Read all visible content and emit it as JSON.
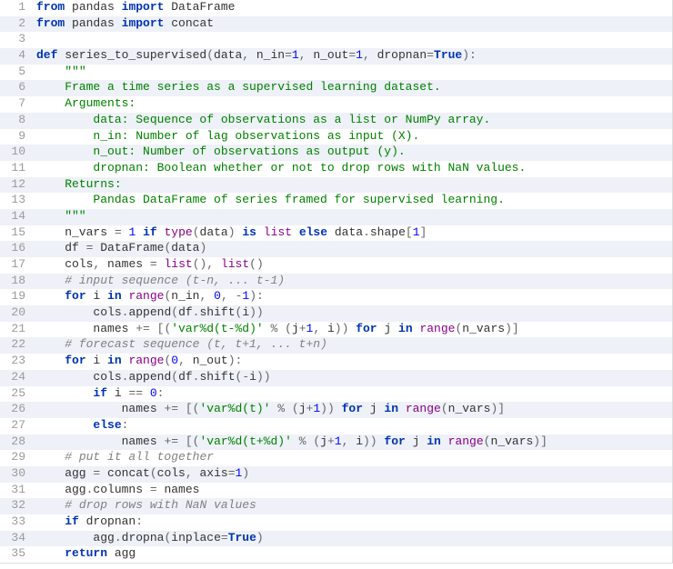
{
  "lines": [
    {
      "n": 1,
      "tokens": [
        [
          "kw",
          "from"
        ],
        [
          "name",
          " pandas "
        ],
        [
          "kw",
          "import"
        ],
        [
          "name",
          " DataFrame"
        ]
      ]
    },
    {
      "n": 2,
      "tokens": [
        [
          "kw",
          "from"
        ],
        [
          "name",
          " pandas "
        ],
        [
          "kw",
          "import"
        ],
        [
          "name",
          " concat"
        ]
      ]
    },
    {
      "n": 3,
      "tokens": []
    },
    {
      "n": 4,
      "tokens": [
        [
          "kw",
          "def"
        ],
        [
          "name",
          " series_to_supervised"
        ],
        [
          "par",
          "("
        ],
        [
          "name",
          "data"
        ],
        [
          "op",
          ","
        ],
        [
          "name",
          " n_in"
        ],
        [
          "op",
          "="
        ],
        [
          "num",
          "1"
        ],
        [
          "op",
          ","
        ],
        [
          "name",
          " n_out"
        ],
        [
          "op",
          "="
        ],
        [
          "num",
          "1"
        ],
        [
          "op",
          ","
        ],
        [
          "name",
          " dropnan"
        ],
        [
          "op",
          "="
        ],
        [
          "kw",
          "True"
        ],
        [
          "par",
          ")"
        ],
        [
          "op",
          ":"
        ]
      ]
    },
    {
      "n": 5,
      "tokens": [
        [
          "name",
          "    "
        ],
        [
          "str",
          "\"\"\""
        ]
      ]
    },
    {
      "n": 6,
      "tokens": [
        [
          "str",
          "    Frame a time series as a supervised learning dataset."
        ]
      ]
    },
    {
      "n": 7,
      "tokens": [
        [
          "str",
          "    Arguments:"
        ]
      ]
    },
    {
      "n": 8,
      "tokens": [
        [
          "str",
          "        data: Sequence of observations as a list or NumPy array."
        ]
      ]
    },
    {
      "n": 9,
      "tokens": [
        [
          "str",
          "        n_in: Number of lag observations as input (X)."
        ]
      ]
    },
    {
      "n": 10,
      "tokens": [
        [
          "str",
          "        n_out: Number of observations as output (y)."
        ]
      ]
    },
    {
      "n": 11,
      "tokens": [
        [
          "str",
          "        dropnan: Boolean whether or not to drop rows with NaN values."
        ]
      ]
    },
    {
      "n": 12,
      "tokens": [
        [
          "str",
          "    Returns:"
        ]
      ]
    },
    {
      "n": 13,
      "tokens": [
        [
          "str",
          "        Pandas DataFrame of series framed for supervised learning."
        ]
      ]
    },
    {
      "n": 14,
      "tokens": [
        [
          "str",
          "    \"\"\""
        ]
      ]
    },
    {
      "n": 15,
      "tokens": [
        [
          "name",
          "    n_vars "
        ],
        [
          "op",
          "="
        ],
        [
          "name",
          " "
        ],
        [
          "num",
          "1"
        ],
        [
          "name",
          " "
        ],
        [
          "kw",
          "if"
        ],
        [
          "name",
          " "
        ],
        [
          "bltn",
          "type"
        ],
        [
          "par",
          "("
        ],
        [
          "name",
          "data"
        ],
        [
          "par",
          ")"
        ],
        [
          "name",
          " "
        ],
        [
          "kw",
          "is"
        ],
        [
          "name",
          " "
        ],
        [
          "bltn",
          "list"
        ],
        [
          "name",
          " "
        ],
        [
          "kw",
          "else"
        ],
        [
          "name",
          " data"
        ],
        [
          "op",
          "."
        ],
        [
          "name",
          "shape"
        ],
        [
          "par",
          "["
        ],
        [
          "num",
          "1"
        ],
        [
          "par",
          "]"
        ]
      ]
    },
    {
      "n": 16,
      "tokens": [
        [
          "name",
          "    df "
        ],
        [
          "op",
          "="
        ],
        [
          "name",
          " DataFrame"
        ],
        [
          "par",
          "("
        ],
        [
          "name",
          "data"
        ],
        [
          "par",
          ")"
        ]
      ]
    },
    {
      "n": 17,
      "tokens": [
        [
          "name",
          "    cols"
        ],
        [
          "op",
          ","
        ],
        [
          "name",
          " names "
        ],
        [
          "op",
          "="
        ],
        [
          "name",
          " "
        ],
        [
          "bltn",
          "list"
        ],
        [
          "par",
          "()"
        ],
        [
          "op",
          ","
        ],
        [
          "name",
          " "
        ],
        [
          "bltn",
          "list"
        ],
        [
          "par",
          "()"
        ]
      ]
    },
    {
      "n": 18,
      "tokens": [
        [
          "name",
          "    "
        ],
        [
          "cmt",
          "# input sequence (t-n, ... t-1)"
        ]
      ]
    },
    {
      "n": 19,
      "tokens": [
        [
          "name",
          "    "
        ],
        [
          "kw",
          "for"
        ],
        [
          "name",
          " i "
        ],
        [
          "kw",
          "in"
        ],
        [
          "name",
          " "
        ],
        [
          "bltn",
          "range"
        ],
        [
          "par",
          "("
        ],
        [
          "name",
          "n_in"
        ],
        [
          "op",
          ","
        ],
        [
          "name",
          " "
        ],
        [
          "num",
          "0"
        ],
        [
          "op",
          ","
        ],
        [
          "name",
          " "
        ],
        [
          "op",
          "-"
        ],
        [
          "num",
          "1"
        ],
        [
          "par",
          ")"
        ],
        [
          "op",
          ":"
        ]
      ]
    },
    {
      "n": 20,
      "tokens": [
        [
          "name",
          "        cols"
        ],
        [
          "op",
          "."
        ],
        [
          "name",
          "append"
        ],
        [
          "par",
          "("
        ],
        [
          "name",
          "df"
        ],
        [
          "op",
          "."
        ],
        [
          "name",
          "shift"
        ],
        [
          "par",
          "("
        ],
        [
          "name",
          "i"
        ],
        [
          "par",
          "))"
        ]
      ]
    },
    {
      "n": 21,
      "tokens": [
        [
          "name",
          "        names "
        ],
        [
          "op",
          "+="
        ],
        [
          "name",
          " "
        ],
        [
          "par",
          "[("
        ],
        [
          "str",
          "'var%d(t-%d)'"
        ],
        [
          "name",
          " "
        ],
        [
          "op",
          "%"
        ],
        [
          "name",
          " "
        ],
        [
          "par",
          "("
        ],
        [
          "name",
          "j"
        ],
        [
          "op",
          "+"
        ],
        [
          "num",
          "1"
        ],
        [
          "op",
          ","
        ],
        [
          "name",
          " i"
        ],
        [
          "par",
          "))"
        ],
        [
          "name",
          " "
        ],
        [
          "kw",
          "for"
        ],
        [
          "name",
          " j "
        ],
        [
          "kw",
          "in"
        ],
        [
          "name",
          " "
        ],
        [
          "bltn",
          "range"
        ],
        [
          "par",
          "("
        ],
        [
          "name",
          "n_vars"
        ],
        [
          "par",
          ")]"
        ]
      ]
    },
    {
      "n": 22,
      "tokens": [
        [
          "name",
          "    "
        ],
        [
          "cmt",
          "# forecast sequence (t, t+1, ... t+n)"
        ]
      ]
    },
    {
      "n": 23,
      "tokens": [
        [
          "name",
          "    "
        ],
        [
          "kw",
          "for"
        ],
        [
          "name",
          " i "
        ],
        [
          "kw",
          "in"
        ],
        [
          "name",
          " "
        ],
        [
          "bltn",
          "range"
        ],
        [
          "par",
          "("
        ],
        [
          "num",
          "0"
        ],
        [
          "op",
          ","
        ],
        [
          "name",
          " n_out"
        ],
        [
          "par",
          ")"
        ],
        [
          "op",
          ":"
        ]
      ]
    },
    {
      "n": 24,
      "tokens": [
        [
          "name",
          "        cols"
        ],
        [
          "op",
          "."
        ],
        [
          "name",
          "append"
        ],
        [
          "par",
          "("
        ],
        [
          "name",
          "df"
        ],
        [
          "op",
          "."
        ],
        [
          "name",
          "shift"
        ],
        [
          "par",
          "("
        ],
        [
          "op",
          "-"
        ],
        [
          "name",
          "i"
        ],
        [
          "par",
          "))"
        ]
      ]
    },
    {
      "n": 25,
      "tokens": [
        [
          "name",
          "        "
        ],
        [
          "kw",
          "if"
        ],
        [
          "name",
          " i "
        ],
        [
          "op",
          "=="
        ],
        [
          "name",
          " "
        ],
        [
          "num",
          "0"
        ],
        [
          "op",
          ":"
        ]
      ]
    },
    {
      "n": 26,
      "tokens": [
        [
          "name",
          "            names "
        ],
        [
          "op",
          "+="
        ],
        [
          "name",
          " "
        ],
        [
          "par",
          "[("
        ],
        [
          "str",
          "'var%d(t)'"
        ],
        [
          "name",
          " "
        ],
        [
          "op",
          "%"
        ],
        [
          "name",
          " "
        ],
        [
          "par",
          "("
        ],
        [
          "name",
          "j"
        ],
        [
          "op",
          "+"
        ],
        [
          "num",
          "1"
        ],
        [
          "par",
          "))"
        ],
        [
          "name",
          " "
        ],
        [
          "kw",
          "for"
        ],
        [
          "name",
          " j "
        ],
        [
          "kw",
          "in"
        ],
        [
          "name",
          " "
        ],
        [
          "bltn",
          "range"
        ],
        [
          "par",
          "("
        ],
        [
          "name",
          "n_vars"
        ],
        [
          "par",
          ")]"
        ]
      ]
    },
    {
      "n": 27,
      "tokens": [
        [
          "name",
          "        "
        ],
        [
          "kw",
          "else"
        ],
        [
          "op",
          ":"
        ]
      ]
    },
    {
      "n": 28,
      "tokens": [
        [
          "name",
          "            names "
        ],
        [
          "op",
          "+="
        ],
        [
          "name",
          " "
        ],
        [
          "par",
          "[("
        ],
        [
          "str",
          "'var%d(t+%d)'"
        ],
        [
          "name",
          " "
        ],
        [
          "op",
          "%"
        ],
        [
          "name",
          " "
        ],
        [
          "par",
          "("
        ],
        [
          "name",
          "j"
        ],
        [
          "op",
          "+"
        ],
        [
          "num",
          "1"
        ],
        [
          "op",
          ","
        ],
        [
          "name",
          " i"
        ],
        [
          "par",
          "))"
        ],
        [
          "name",
          " "
        ],
        [
          "kw",
          "for"
        ],
        [
          "name",
          " j "
        ],
        [
          "kw",
          "in"
        ],
        [
          "name",
          " "
        ],
        [
          "bltn",
          "range"
        ],
        [
          "par",
          "("
        ],
        [
          "name",
          "n_vars"
        ],
        [
          "par",
          ")]"
        ]
      ]
    },
    {
      "n": 29,
      "tokens": [
        [
          "name",
          "    "
        ],
        [
          "cmt",
          "# put it all together"
        ]
      ]
    },
    {
      "n": 30,
      "tokens": [
        [
          "name",
          "    agg "
        ],
        [
          "op",
          "="
        ],
        [
          "name",
          " concat"
        ],
        [
          "par",
          "("
        ],
        [
          "name",
          "cols"
        ],
        [
          "op",
          ","
        ],
        [
          "name",
          " axis"
        ],
        [
          "op",
          "="
        ],
        [
          "num",
          "1"
        ],
        [
          "par",
          ")"
        ]
      ]
    },
    {
      "n": 31,
      "tokens": [
        [
          "name",
          "    agg"
        ],
        [
          "op",
          "."
        ],
        [
          "name",
          "columns "
        ],
        [
          "op",
          "="
        ],
        [
          "name",
          " names"
        ]
      ]
    },
    {
      "n": 32,
      "tokens": [
        [
          "name",
          "    "
        ],
        [
          "cmt",
          "# drop rows with NaN values"
        ]
      ]
    },
    {
      "n": 33,
      "tokens": [
        [
          "name",
          "    "
        ],
        [
          "kw",
          "if"
        ],
        [
          "name",
          " dropnan"
        ],
        [
          "op",
          ":"
        ]
      ]
    },
    {
      "n": 34,
      "tokens": [
        [
          "name",
          "        agg"
        ],
        [
          "op",
          "."
        ],
        [
          "name",
          "dropna"
        ],
        [
          "par",
          "("
        ],
        [
          "name",
          "inplace"
        ],
        [
          "op",
          "="
        ],
        [
          "kw",
          "True"
        ],
        [
          "par",
          ")"
        ]
      ]
    },
    {
      "n": 35,
      "tokens": [
        [
          "name",
          "    "
        ],
        [
          "kw",
          "return"
        ],
        [
          "name",
          " agg"
        ]
      ]
    }
  ]
}
